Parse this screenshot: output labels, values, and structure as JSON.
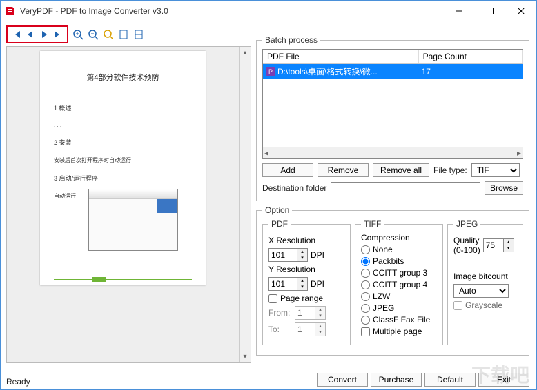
{
  "window": {
    "title": "VeryPDF - PDF to Image Converter v3.0"
  },
  "batch": {
    "legend": "Batch process",
    "cols": {
      "file": "PDF File",
      "pages": "Page Count"
    },
    "row": {
      "path": "D:\\tools\\桌面\\格式转换\\微...",
      "pages": "17"
    },
    "add": "Add",
    "remove": "Remove",
    "removeall": "Remove all",
    "filetype_label": "File type:",
    "filetype": "TIF",
    "dest_label": "Destination folder",
    "dest_value": "",
    "browse": "Browse"
  },
  "preview": {
    "title": "第4部分软件技术预防",
    "l1": "1  概述",
    "l2": "2  安装",
    "l3": "安装后首次打开程序时自动运行",
    "l4": "3  启动/运行程序",
    "l5": "自动运行"
  },
  "option": {
    "legend": "Option",
    "pdf": {
      "legend": "PDF",
      "xres": "X Resolution",
      "xval": "101",
      "yres": "Y Resolution",
      "yval": "101",
      "dpi": "DPI",
      "pagerange": "Page range",
      "from": "From:",
      "from_val": "1",
      "to": "To:",
      "to_val": "1"
    },
    "tiff": {
      "legend": "TIFF",
      "compression": "Compression",
      "none": "None",
      "packbits": "Packbits",
      "cg3": "CCITT group 3",
      "cg4": "CCITT group 4",
      "lzw": "LZW",
      "jpeg": "JPEG",
      "classf": "ClassF Fax File",
      "multipage": "Multiple page"
    },
    "jpeg": {
      "legend": "JPEG",
      "quality1": "Quality",
      "quality2": "(0-100)",
      "qval": "75",
      "bitcount": "Image bitcount",
      "auto": "Auto",
      "grayscale": "Grayscale"
    }
  },
  "buttons": {
    "convert": "Convert",
    "purchase": "Purchase",
    "default": "Default",
    "exit": "Exit"
  },
  "status": "Ready"
}
